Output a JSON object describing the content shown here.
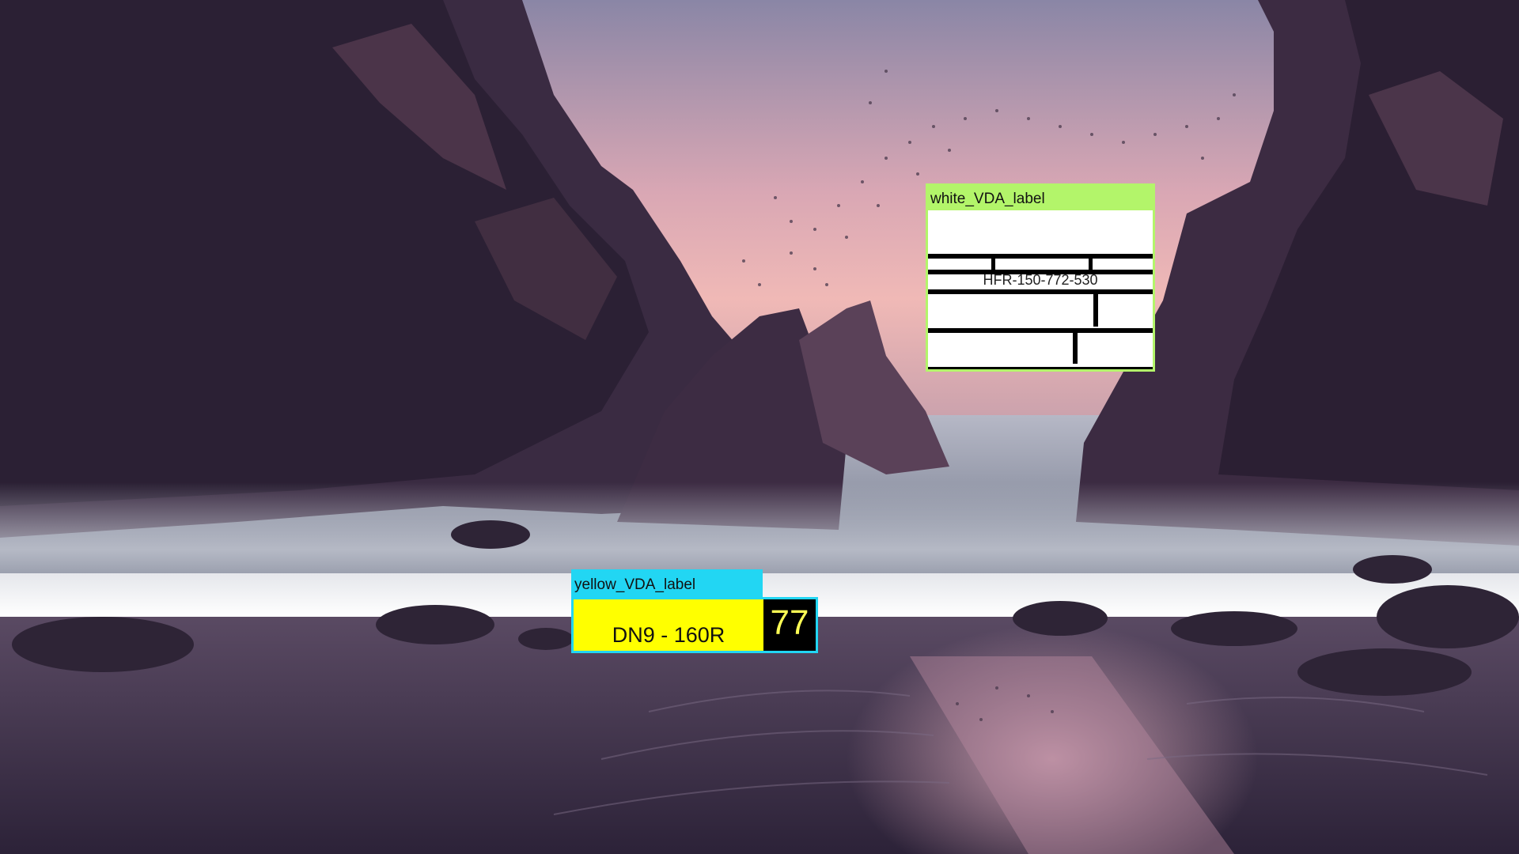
{
  "white_label": {
    "tag": "white_VDA_label",
    "id_text": "HFR-150-772-530",
    "tag_color": "#b3f56a"
  },
  "yellow_label": {
    "tag": "yellow_VDA_label",
    "code": "DN9 - 160R",
    "number": "77",
    "tag_color": "#22d6f3",
    "body_color": "#ffff00"
  }
}
